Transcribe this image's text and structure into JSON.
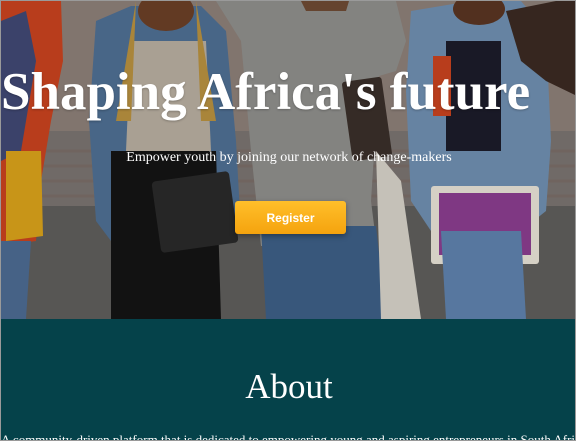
{
  "hero": {
    "title": "Shaping Africa's future",
    "subtitle": "Empower youth by joining our network of change-makers",
    "register_label": "Register",
    "image_alt_icon": "group-of-young-people-photo"
  },
  "about": {
    "heading": "About",
    "text": "A community-driven platform that is dedicated to empowering young and aspiring entrepreneurs in South Africa"
  },
  "colors": {
    "accent": "#f7a81b",
    "about_background": "#05424a",
    "text": "#ffffff"
  }
}
